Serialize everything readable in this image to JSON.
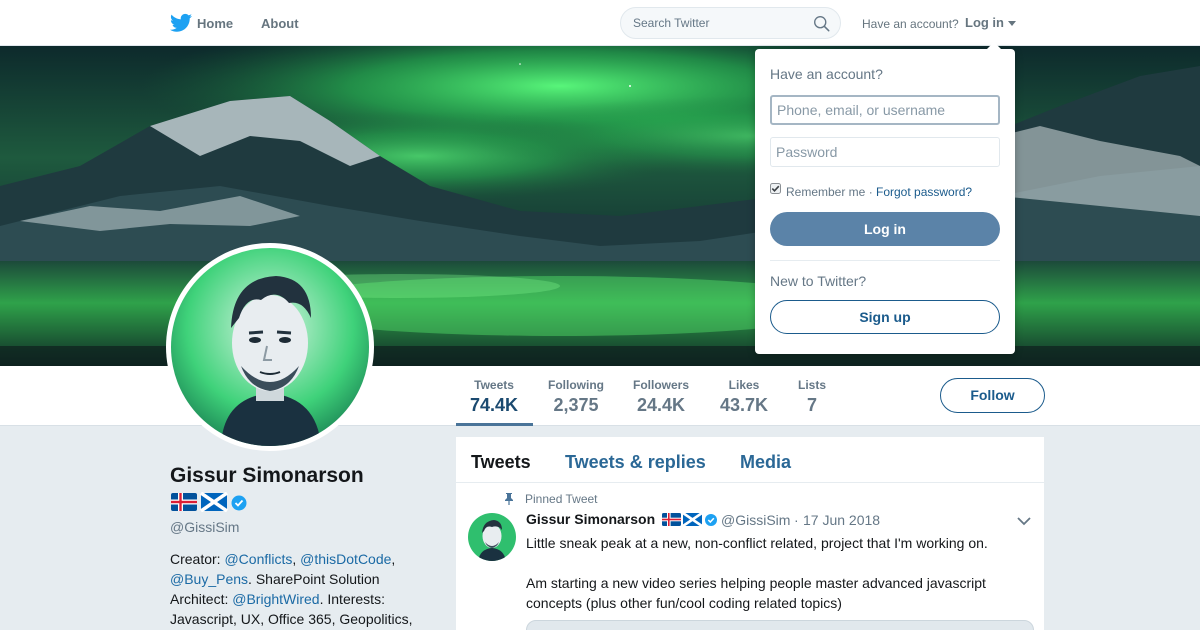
{
  "nav": {
    "home": "Home",
    "about": "About",
    "search_placeholder": "Search Twitter",
    "have_account": "Have an account?",
    "login": "Log in"
  },
  "stats": [
    {
      "label": "Tweets",
      "value": "74.4K"
    },
    {
      "label": "Following",
      "value": "2,375"
    },
    {
      "label": "Followers",
      "value": "24.4K"
    },
    {
      "label": "Likes",
      "value": "43.7K"
    },
    {
      "label": "Lists",
      "value": "7"
    }
  ],
  "follow_label": "Follow",
  "profile": {
    "name": "Gissur Simonarson",
    "handle": "@GissiSim",
    "bio": {
      "t1": "Creator: ",
      "m1": "@Conflicts",
      "t2": ", ",
      "m2": "@thisDotCode",
      "t3": ",",
      "m3": "@Buy_Pens",
      "t4": ". SharePoint Solution Architect: ",
      "m4": "@BrightWired",
      "t5": ". Interests: Javascript, UX, Office 365, Geopolitics,"
    }
  },
  "timeline": {
    "tabs": [
      "Tweets",
      "Tweets & replies",
      "Media"
    ],
    "pinned_label": "Pinned Tweet",
    "tweet": {
      "name": "Gissur Simonarson",
      "handle": "@GissiSim",
      "separator": "·",
      "date": "17 Jun 2018",
      "text1": "Little sneak peak at a new, non-conflict related, project that I'm working on.",
      "text2": "Am starting a new video series helping people master advanced javascript concepts (plus other fun/cool coding related topics)"
    }
  },
  "login_dropdown": {
    "title": "Have an account?",
    "user_placeholder": "Phone, email, or username",
    "password_placeholder": "Password",
    "remember": "Remember me",
    "separator": "·",
    "forgot": "Forgot password?",
    "login_button": "Log in",
    "new_text": "New to Twitter?",
    "signup_button": "Sign up"
  },
  "colors": {
    "link": "#1b6aa5",
    "login_button_bg": "#5b83a8",
    "verified": "#1da1f2",
    "aurora": "#3cff6e"
  },
  "icons": [
    "twitter-bird-icon",
    "search-icon",
    "caret-down-icon",
    "verified-icon",
    "pin-icon",
    "chevron-down-icon",
    "iceland-flag-icon",
    "scotland-flag-icon"
  ]
}
